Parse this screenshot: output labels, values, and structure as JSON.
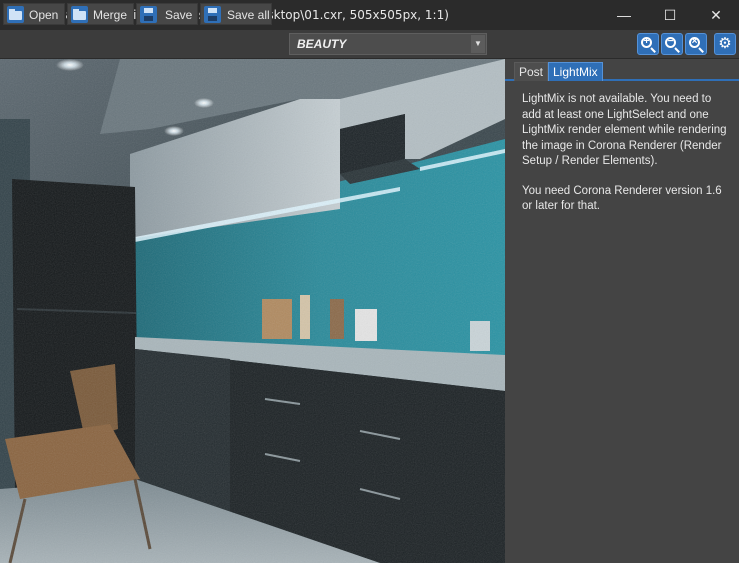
{
  "window": {
    "title": "Corona Image Editor 2 (C:\\Users\\Nik\\Desktop\\01.cxr, 505x505px, 1:1)",
    "minimize_symbol": "—",
    "maximize_symbol": "☐",
    "close_symbol": "✕"
  },
  "toolbar": {
    "open_label": "Open",
    "merge_label": "Merge",
    "save_label": "Save",
    "save_all_label": "Save all",
    "render_element": "BEAUTY",
    "zoom_in_symbol": "+",
    "zoom_out_symbol": "−",
    "zoom_fit_symbol": "×",
    "settings_symbol": "⚙"
  },
  "panel": {
    "tabs": [
      {
        "label": "Post",
        "active": false
      },
      {
        "label": "LightMix",
        "active": true
      }
    ],
    "message_1": "LightMix is not available. You need to add at least one LightSelect and one LightMix render element while rendering the image in Corona Renderer (Render Setup / Render Elements).",
    "message_2": "You need Corona Renderer version 1.6 or later for that."
  },
  "colors": {
    "accent": "#2f6fb7",
    "background": "#2b2b2b",
    "panel": "#444444",
    "backsplash": "#2a8a9a"
  },
  "icons": [
    "app-icon",
    "folder-open-icon",
    "folder-merge-icon",
    "save-disk-icon",
    "save-all-disk-icon",
    "dropdown-arrow-icon",
    "zoom-in-icon",
    "zoom-out-icon",
    "zoom-fit-icon",
    "gear-icon"
  ]
}
